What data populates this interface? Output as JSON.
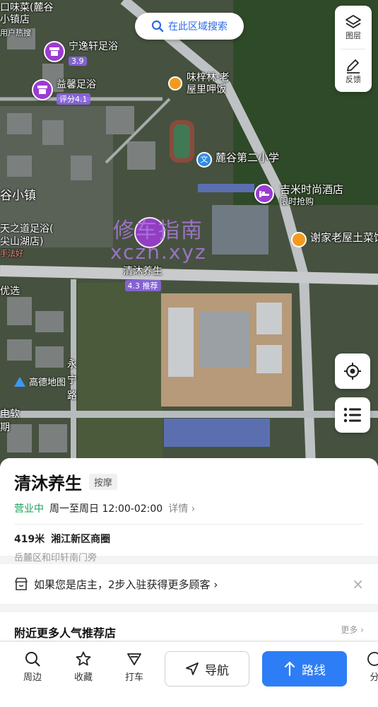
{
  "map": {
    "search_button": "在此区域搜索",
    "layers_label": "图层",
    "feedback_label": "反馈",
    "amap_logo": "高德地图",
    "watermark_line1": "修车指南",
    "watermark_line2": "xczn.xyz",
    "pois": [
      {
        "name": "宁逸轩足浴",
        "sub": "3.9"
      },
      {
        "name": "益馨足浴",
        "sub": "评分4.1"
      },
      {
        "name": "清沐养生",
        "sub": "4.3 推荐"
      }
    ],
    "labels": {
      "top_left_1": "口味菜(麓谷",
      "top_left_2": "小镇店",
      "top_left_3": "用户热搜",
      "restaurant_1_line1": "味梓林·老",
      "restaurant_1_line2": "屋里呷饭",
      "school": "麓谷第二小学",
      "hotel": "吉米时尚酒店",
      "hotel_sub": "限时抢购",
      "restaurant_2": "谢家老屋土菜馆",
      "town": "谷小镇",
      "spa_left_1": "天之道足浴(",
      "spa_left_2": "尖山湖店)",
      "spa_left_3": "手法好",
      "youxuan": "优选",
      "road_1": "永",
      "road_2": "宁",
      "road_3": "路",
      "left_edge_1": "电软",
      "left_edge_2": "期"
    }
  },
  "place": {
    "name": "清沐养生",
    "category": "按摩",
    "status": "营业中",
    "hours": "周一至周日 12:00-02:00",
    "details": "详情",
    "distance": "419米",
    "district": "湘江新区商圈",
    "address": "岳麓区和印轩南门旁"
  },
  "owner_prompt": "如果您是店主，2步入驻获得更多顾客",
  "nearby": {
    "title": "附近更多人气推荐店",
    "more": "更多"
  },
  "bottom_bar": {
    "nearby": "周边",
    "favorite": "收藏",
    "taxi": "打车",
    "navigate": "导航",
    "route": "路线",
    "share": "分"
  }
}
